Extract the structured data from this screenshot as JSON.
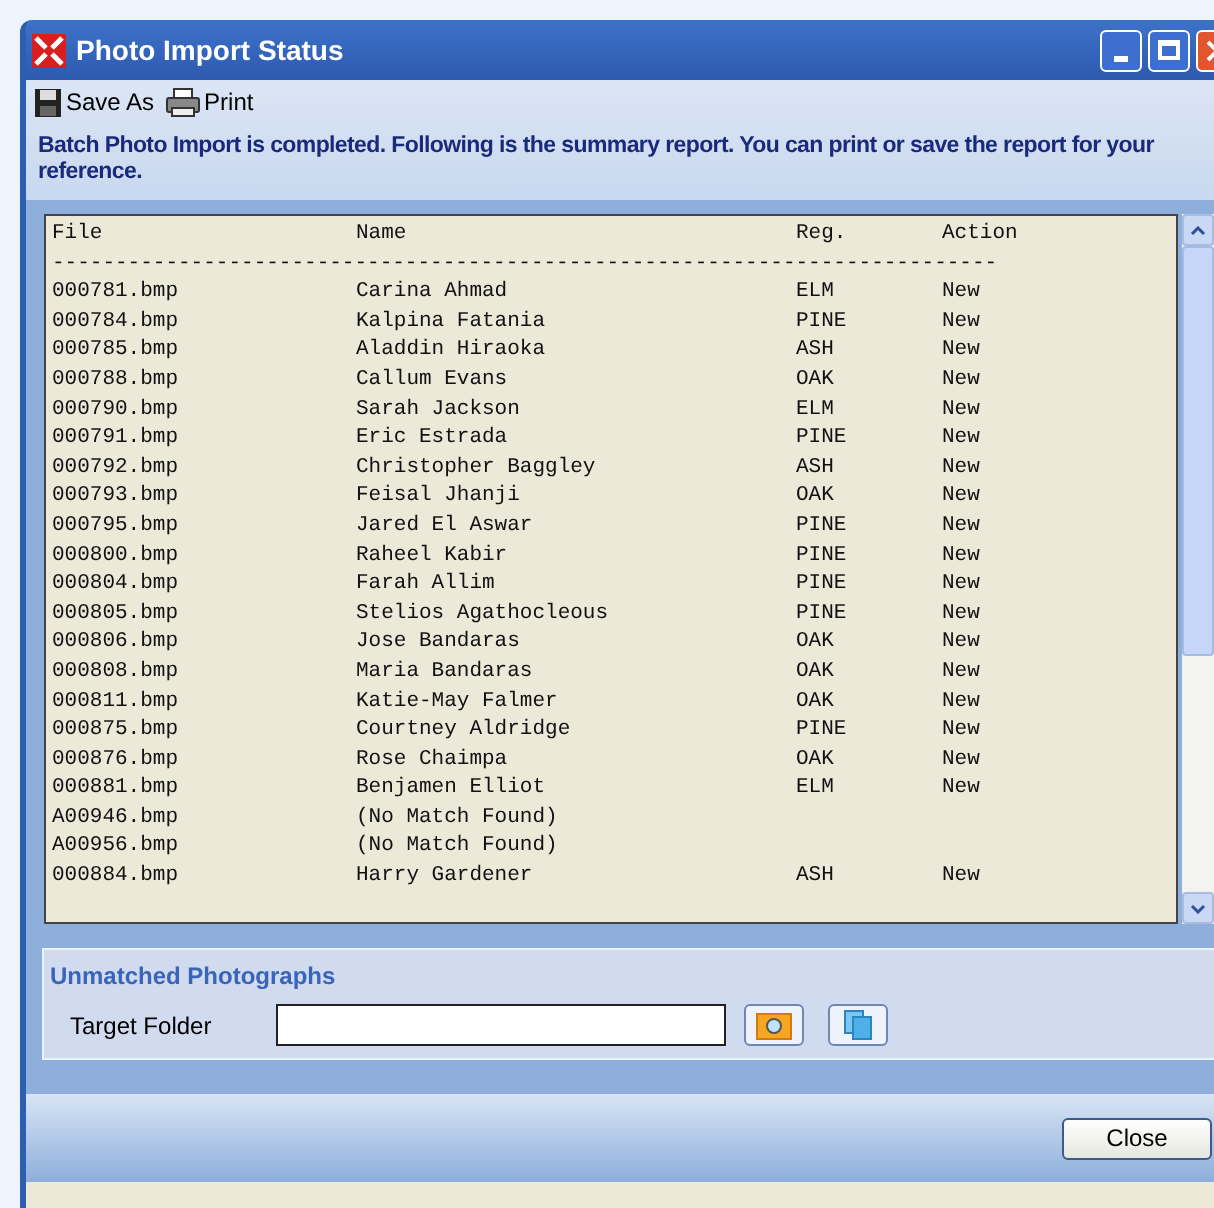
{
  "window": {
    "title": "Photo Import Status"
  },
  "toolbar": [
    {
      "kind": "save",
      "label": "Save As"
    },
    {
      "kind": "print",
      "label": "Print"
    }
  ],
  "message": "Batch Photo Import is completed. Following is the summary report. You can print or save the report for your reference.",
  "report": {
    "columns": [
      "File",
      "Name",
      "Reg.",
      "Action"
    ],
    "separator": "---------------------------------------------------------------------------",
    "rows": [
      {
        "file": "000781.bmp",
        "name": "Carina Ahmad",
        "reg": "ELM",
        "action": "New"
      },
      {
        "file": "000784.bmp",
        "name": "Kalpina Fatania",
        "reg": "PINE",
        "action": "New"
      },
      {
        "file": "000785.bmp",
        "name": "Aladdin Hiraoka",
        "reg": "ASH",
        "action": "New"
      },
      {
        "file": "000788.bmp",
        "name": "Callum Evans",
        "reg": "OAK",
        "action": "New"
      },
      {
        "file": "000790.bmp",
        "name": "Sarah Jackson",
        "reg": "ELM",
        "action": "New"
      },
      {
        "file": "000791.bmp",
        "name": "Eric Estrada",
        "reg": "PINE",
        "action": "New"
      },
      {
        "file": "000792.bmp",
        "name": "Christopher Baggley",
        "reg": "ASH",
        "action": "New"
      },
      {
        "file": "000793.bmp",
        "name": "Feisal Jhanji",
        "reg": "OAK",
        "action": "New"
      },
      {
        "file": "000795.bmp",
        "name": "Jared El Aswar",
        "reg": "PINE",
        "action": "New"
      },
      {
        "file": "000800.bmp",
        "name": "Raheel Kabir",
        "reg": "PINE",
        "action": "New"
      },
      {
        "file": "000804.bmp",
        "name": "Farah Allim",
        "reg": "PINE",
        "action": "New"
      },
      {
        "file": "000805.bmp",
        "name": "Stelios Agathocleous",
        "reg": "PINE",
        "action": "New"
      },
      {
        "file": "000806.bmp",
        "name": "Jose Bandaras",
        "reg": "OAK",
        "action": "New"
      },
      {
        "file": "000808.bmp",
        "name": "Maria Bandaras",
        "reg": "OAK",
        "action": "New"
      },
      {
        "file": "000811.bmp",
        "name": "Katie-May Falmer",
        "reg": "OAK",
        "action": "New"
      },
      {
        "file": "000875.bmp",
        "name": "Courtney Aldridge",
        "reg": "PINE",
        "action": "New"
      },
      {
        "file": "000876.bmp",
        "name": "Rose Chaimpa",
        "reg": "OAK",
        "action": "New"
      },
      {
        "file": "000881.bmp",
        "name": "Benjamen Elliot",
        "reg": "ELM",
        "action": "New"
      },
      {
        "file": "A00946.bmp",
        "name": "(No Match Found)"
      },
      {
        "file": "A00956.bmp",
        "name": "(No Match Found)"
      },
      {
        "file": "000884.bmp",
        "name": "Harry Gardener",
        "reg": "ASH",
        "action": "New"
      }
    ]
  },
  "unmatched": {
    "title": "Unmatched Photographs",
    "label": "Target Folder"
  },
  "buttons": [
    "Close"
  ]
}
